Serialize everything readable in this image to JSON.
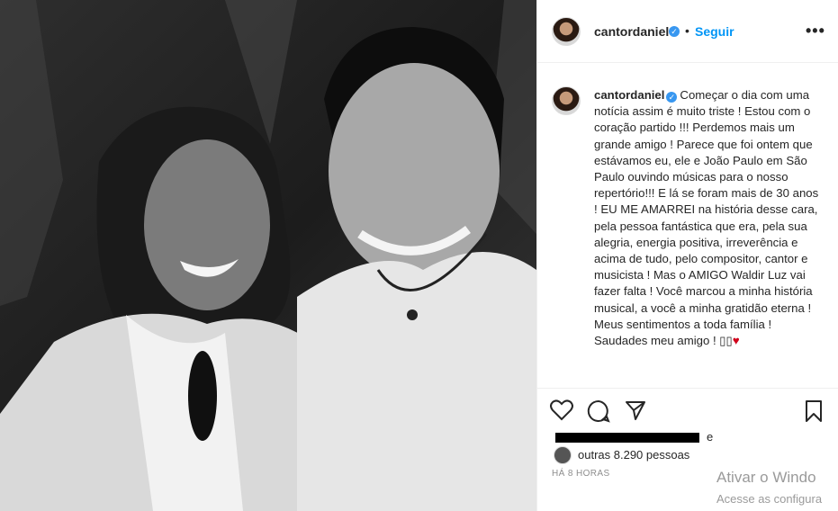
{
  "post": {
    "photo_alt": "",
    "header": {
      "username": "cantordaniel",
      "verified_mark": "✓",
      "separator": "•",
      "follow_label": "Seguir",
      "more_label": "•••"
    },
    "caption": {
      "username": "cantordaniel",
      "verified_mark": "✓",
      "text": "Começar o dia com uma notícia assim é muito triste ! Estou com o coração partido !!! Perdemos mais um grande amigo ! Parece que foi ontem que estávamos eu, ele e João Paulo em São Paulo ouvindo músicas para o nosso repertório!!! E lá se foram mais de 30 anos ! EU ME AMARREI na história desse cara, pela pessoa fantástica que era, pela sua alegria, energia positiva, irreverência e acima de tudo, pelo compositor, cantor e musicista ! Mas o AMIGO Waldir Luz vai fazer falta ! Você marcou a minha história musical, a você a minha gratidão eterna ! Meus sentimentos a toda família ! Saudades meu amigo ! ",
      "emoji_boxes": "▯▯",
      "heart": "♥"
    },
    "actions": {
      "like_icon": "heart-outline-icon",
      "comment_icon": "comment-icon",
      "share_icon": "send-icon",
      "save_icon": "bookmark-icon"
    },
    "likes": {
      "e": "e",
      "others": "outras 8.290 pessoas"
    },
    "time": "HÁ 8 HORAS"
  },
  "os_watermark": {
    "line1": "Ativar o Windo",
    "line2": "Acesse as configura"
  },
  "colors": {
    "accent": "#0095f6",
    "verified": "#3897f0",
    "heart": "#d0021b"
  }
}
